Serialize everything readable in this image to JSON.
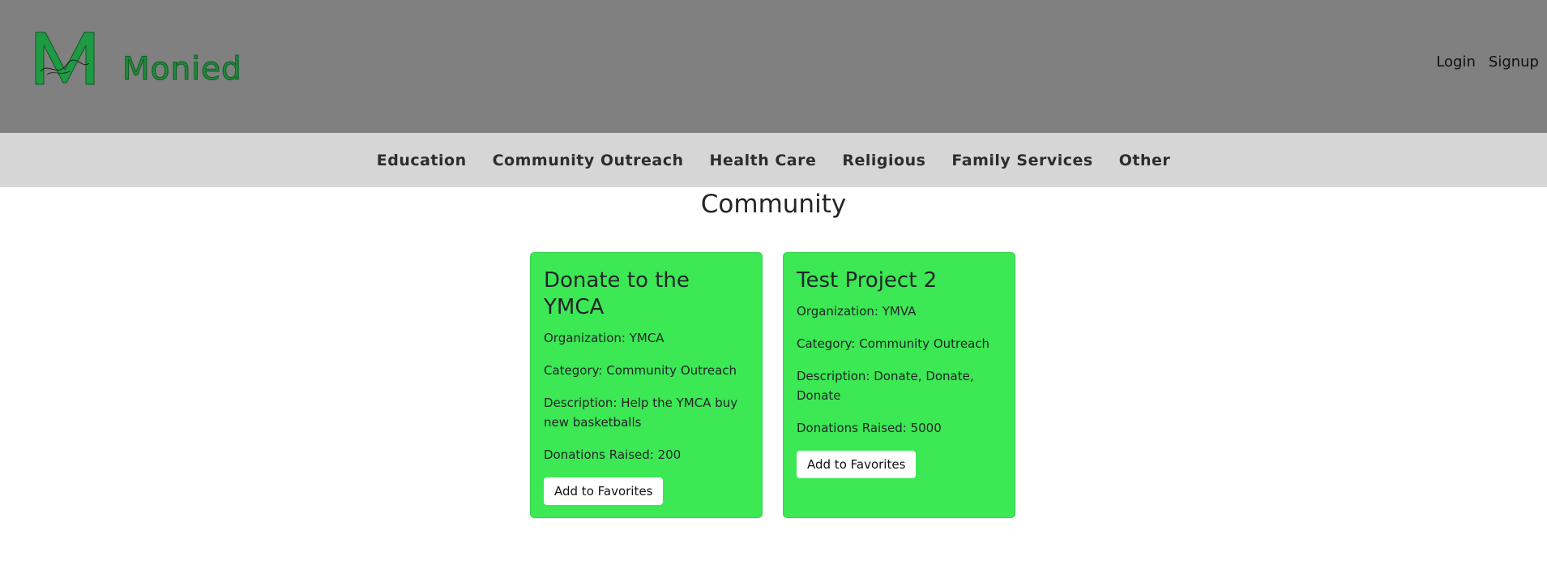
{
  "header": {
    "brand": "Monied",
    "login_label": "Login",
    "signup_label": "Signup"
  },
  "nav": {
    "items": [
      "Education",
      "Community Outreach",
      "Health Care",
      "Religious",
      "Family Services",
      "Other"
    ]
  },
  "page": {
    "title": "Community"
  },
  "cards": [
    {
      "title": "Donate to the YMCA",
      "organization": "Organization: YMCA",
      "category": "Category: Community Outreach",
      "description": "Description: Help the YMCA buy new basketballs",
      "donations": "Donations Raised: 200",
      "button": "Add to Favorites"
    },
    {
      "title": "Test Project 2",
      "organization": "Organization: YMVA",
      "category": "Category: Community Outreach",
      "description": "Description: Donate, Donate, Donate",
      "donations": "Donations Raised: 5000",
      "button": "Add to Favorites"
    }
  ],
  "colors": {
    "header_bg": "#808080",
    "nav_bg": "#d6d6d6",
    "card_bg": "#3ce854",
    "brand_green": "#1f8a3a"
  },
  "icons": {
    "logo": "monied-m-logo"
  }
}
